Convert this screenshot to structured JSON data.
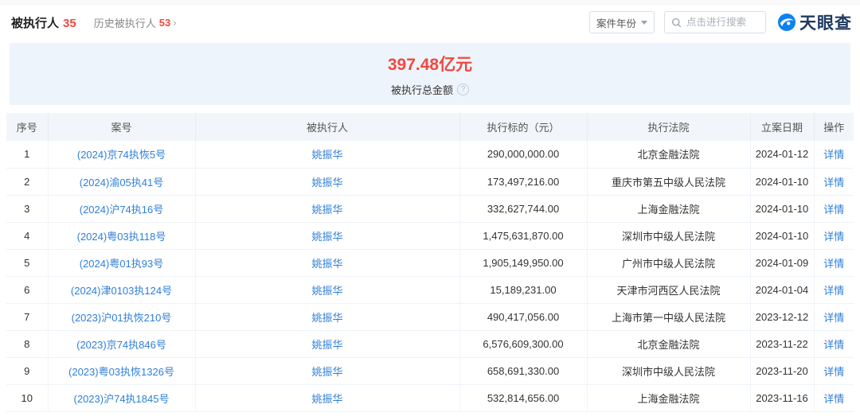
{
  "tabs": {
    "main_label": "被执行人",
    "main_count": "35",
    "history_label": "历史被执行人",
    "history_count": "53",
    "history_chevron": "›"
  },
  "controls": {
    "year_filter_label": "案件年份",
    "search_placeholder": "点击进行搜索",
    "logo_text": "天眼查"
  },
  "summary": {
    "amount": "397.48亿元",
    "label": "被执行总金额"
  },
  "table": {
    "headers": [
      "序号",
      "案号",
      "被执行人",
      "执行标的（元）",
      "执行法院",
      "立案日期",
      "操作"
    ],
    "detail_label": "详情",
    "rows": [
      {
        "no": "1",
        "case_no": "(2024)京74执恢5号",
        "person": "姚振华",
        "amount": "290,000,000.00",
        "court": "北京金融法院",
        "date": "2024-01-12"
      },
      {
        "no": "2",
        "case_no": "(2024)渝05执41号",
        "person": "姚振华",
        "amount": "173,497,216.00",
        "court": "重庆市第五中级人民法院",
        "date": "2024-01-10"
      },
      {
        "no": "3",
        "case_no": "(2024)沪74执16号",
        "person": "姚振华",
        "amount": "332,627,744.00",
        "court": "上海金融法院",
        "date": "2024-01-10"
      },
      {
        "no": "4",
        "case_no": "(2024)粤03执118号",
        "person": "姚振华",
        "amount": "1,475,631,870.00",
        "court": "深圳市中级人民法院",
        "date": "2024-01-10"
      },
      {
        "no": "5",
        "case_no": "(2024)粤01执93号",
        "person": "姚振华",
        "amount": "1,905,149,950.00",
        "court": "广州市中级人民法院",
        "date": "2024-01-09"
      },
      {
        "no": "6",
        "case_no": "(2024)津0103执124号",
        "person": "姚振华",
        "amount": "15,189,231.00",
        "court": "天津市河西区人民法院",
        "date": "2024-01-04"
      },
      {
        "no": "7",
        "case_no": "(2023)沪01执恢210号",
        "person": "姚振华",
        "amount": "490,417,056.00",
        "court": "上海市第一中级人民法院",
        "date": "2023-12-12"
      },
      {
        "no": "8",
        "case_no": "(2023)京74执846号",
        "person": "姚振华",
        "amount": "6,576,609,300.00",
        "court": "北京金融法院",
        "date": "2023-11-22"
      },
      {
        "no": "9",
        "case_no": "(2023)粤03执恢1326号",
        "person": "姚振华",
        "amount": "658,691,330.00",
        "court": "深圳市中级人民法院",
        "date": "2023-11-20"
      },
      {
        "no": "10",
        "case_no": "(2023)沪74执1845号",
        "person": "姚振华",
        "amount": "532,814,656.00",
        "court": "上海金融法院",
        "date": "2023-11-16"
      }
    ]
  },
  "colors": {
    "accent_red": "#f2483f",
    "link_blue": "#2f7fd8",
    "brand_blue": "#0b82f0",
    "banner_bg": "#eef4fb",
    "table_header_bg": "#f2f5fa"
  }
}
